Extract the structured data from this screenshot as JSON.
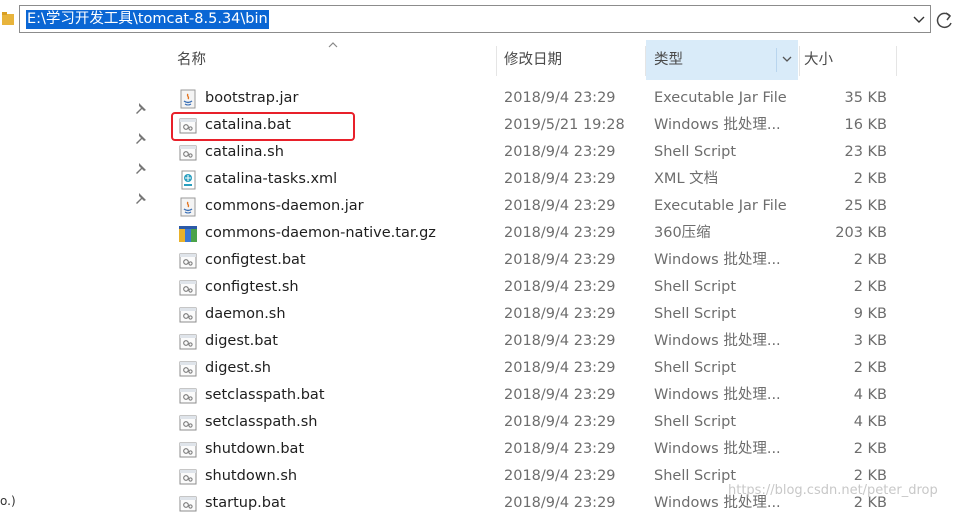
{
  "address_bar": {
    "path": "E:\\学习开发工具\\tomcat-8.5.34\\bin"
  },
  "columns": {
    "name": "名称",
    "date": "修改日期",
    "type": "类型",
    "size": "大小"
  },
  "nav": {
    "truncated_item": "o.)"
  },
  "files": [
    {
      "name": "bootstrap.jar",
      "date": "2018/9/4 23:29",
      "type": "Executable Jar File",
      "size": "35 KB",
      "icon": "java-jar-icon"
    },
    {
      "name": "catalina.bat",
      "date": "2019/5/21 19:28",
      "type": "Windows 批处理...",
      "size": "16 KB",
      "icon": "batch-file-icon"
    },
    {
      "name": "catalina.sh",
      "date": "2018/9/4 23:29",
      "type": "Shell Script",
      "size": "23 KB",
      "icon": "shell-script-icon"
    },
    {
      "name": "catalina-tasks.xml",
      "date": "2018/9/4 23:29",
      "type": "XML 文档",
      "size": "2 KB",
      "icon": "xml-document-icon"
    },
    {
      "name": "commons-daemon.jar",
      "date": "2018/9/4 23:29",
      "type": "Executable Jar File",
      "size": "25 KB",
      "icon": "java-jar-icon"
    },
    {
      "name": "commons-daemon-native.tar.gz",
      "date": "2018/9/4 23:29",
      "type": "360压缩",
      "size": "203 KB",
      "icon": "archive-icon"
    },
    {
      "name": "configtest.bat",
      "date": "2018/9/4 23:29",
      "type": "Windows 批处理...",
      "size": "2 KB",
      "icon": "batch-file-icon"
    },
    {
      "name": "configtest.sh",
      "date": "2018/9/4 23:29",
      "type": "Shell Script",
      "size": "2 KB",
      "icon": "shell-script-icon"
    },
    {
      "name": "daemon.sh",
      "date": "2018/9/4 23:29",
      "type": "Shell Script",
      "size": "9 KB",
      "icon": "shell-script-icon"
    },
    {
      "name": "digest.bat",
      "date": "2018/9/4 23:29",
      "type": "Windows 批处理...",
      "size": "3 KB",
      "icon": "batch-file-icon"
    },
    {
      "name": "digest.sh",
      "date": "2018/9/4 23:29",
      "type": "Shell Script",
      "size": "2 KB",
      "icon": "shell-script-icon"
    },
    {
      "name": "setclasspath.bat",
      "date": "2018/9/4 23:29",
      "type": "Windows 批处理...",
      "size": "4 KB",
      "icon": "batch-file-icon"
    },
    {
      "name": "setclasspath.sh",
      "date": "2018/9/4 23:29",
      "type": "Shell Script",
      "size": "4 KB",
      "icon": "shell-script-icon"
    },
    {
      "name": "shutdown.bat",
      "date": "2018/9/4 23:29",
      "type": "Windows 批处理...",
      "size": "2 KB",
      "icon": "batch-file-icon"
    },
    {
      "name": "shutdown.sh",
      "date": "2018/9/4 23:29",
      "type": "Shell Script",
      "size": "2 KB",
      "icon": "shell-script-icon"
    },
    {
      "name": "startup.bat",
      "date": "2018/9/4 23:29",
      "type": "Windows 批处理...",
      "size": "2 KB",
      "icon": "batch-file-icon"
    }
  ],
  "watermark": "https://blog.csdn.net/peter_drop",
  "colors": {
    "selection": "#0a66d4",
    "highlight_box": "#e8202a",
    "sorted_column_bg": "#d9ebf9"
  }
}
